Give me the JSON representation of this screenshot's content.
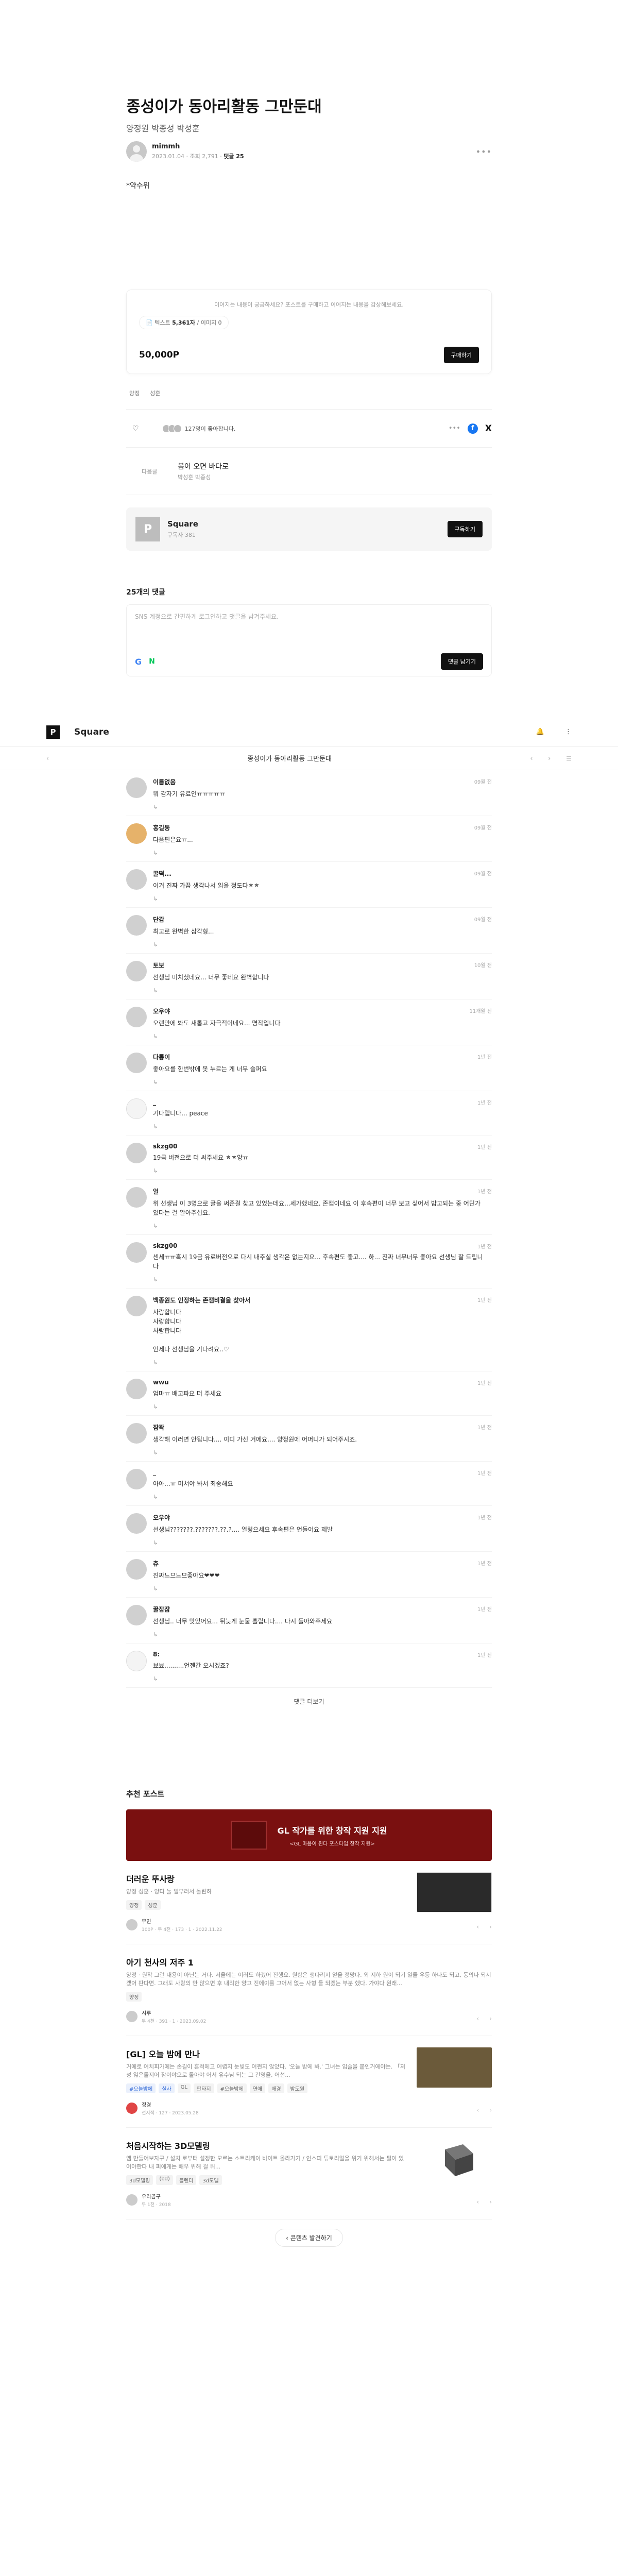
{
  "post": {
    "title": "종성이가 동아리활동 그만둔대",
    "subtitle": "양정원 박종성 박성훈",
    "author": "mimmh",
    "date": "2023.01.04",
    "views": "조회 2,791",
    "comments": "댓글 25",
    "body_text": "*약수위",
    "more": "•••"
  },
  "paywall": {
    "note": "이어지는 내용이 궁금하세요? 포스트를 구매하고 이어지는 내용을 감상해보세요.",
    "chip_prefix": "텍스트",
    "chip_count": "5,361자",
    "chip_suffix": "/ 이미지 0",
    "price": "50,000P",
    "buy_label": "구매하기"
  },
  "tags": [
    "양정",
    "성훈"
  ],
  "likes": {
    "icon": "♡",
    "text": "127명이 좋아합니다.",
    "dots": "•••",
    "fb": "f",
    "x": "X"
  },
  "next_post": {
    "label": "다음글",
    "title": "봄이 오면 바다로",
    "sub": "박성훈 박종성"
  },
  "channel": {
    "logo": "P",
    "name": "Square",
    "subs": "구독자 381",
    "subscribe_label": "구독하기"
  },
  "comment_section": {
    "count_label": "25개의 댓글",
    "placeholder": "SNS 계정으로 간편하게 로그인하고 댓글을 남겨주세요.",
    "google": "G",
    "naver": "N",
    "submit_label": "댓글 남기기"
  },
  "site_nav": {
    "logo": "P",
    "name": "Square",
    "icon1": "🔔",
    "icon2": "⋮"
  },
  "sub_nav": {
    "left": "‹",
    "title": "종성이가 동아리활동 그만둔대",
    "right1": "‹",
    "right2": "›",
    "right3": "☰"
  },
  "comments": [
    {
      "name": "이름없음",
      "text": "뭐 감자기 유료인ㅠㅠㅠㅠㅠ",
      "date": "09월 전",
      "reply": "↳"
    },
    {
      "name": "홍길동",
      "text": "다음편은요ㅠ...",
      "date": "09월 전",
      "reply": "↳"
    },
    {
      "name": "꿀떡...",
      "text": "이거 진짜 가끔 생각나서 읽을 정도다ㅎㅎ",
      "date": "09월 전",
      "reply": "↳"
    },
    {
      "name": "단감",
      "text": "최고로 완벽한 삼각형...",
      "date": "09월 전",
      "reply": "↳"
    },
    {
      "name": "토보",
      "text": "선생님 미치셨네요... 너무 좋네요 완벽합니다",
      "date": "10월 전",
      "reply": "↳"
    },
    {
      "name": "오우야",
      "text": "오랜만에 봐도 새롭고 자극적이네요... 명작입니다",
      "date": "11개월 전",
      "reply": "↳"
    },
    {
      "name": "다롱이",
      "text": "좋아요를 한번밖에 못 누르는 게 너무 슬퍼요",
      "date": "1년 전",
      "reply": "↳"
    },
    {
      "name": "_",
      "text": "기다립니다... peace",
      "date": "1년 전",
      "reply": "↳"
    },
    {
      "name": "skzg00",
      "text": "19금 버전으로 더 써주세요 ㅎㅎ앙ㅠ",
      "date": "1년 전",
      "reply": "↳"
    },
    {
      "name": "얼",
      "text": "위 선생님 이 3명으로 글을 써준걸 찾고 있었는데요...세가했네요. 존잼이네요 이 후속편이 너무 보고 싶어서 밤고되는 중 어딘가 있다는 걸 알아주십요.",
      "date": "1년 전",
      "reply": "↳"
    },
    {
      "name": "skzg00",
      "text": "센세ㅠㅠ혹시 19금 유료버전으로 다시 내주실 생각은 없는지요... 후속편도 좋고.... 하... 진짜 너무너무 좋아요 선생님 잘 드립니다",
      "date": "1년 전",
      "reply": "↳"
    },
    {
      "name": "백종원도 인정하는 존잼비결을 찾아서",
      "text": "사랑합니다\n사랑합니다\n사랑합니다\n\n언제나 선생님을 기다려요..♡",
      "date": "1년 전",
      "reply": "↳"
    },
    {
      "name": "wwu",
      "text": "엄마ㅠ 배고파요 더 주세요",
      "date": "1년 전",
      "reply": "↳"
    },
    {
      "name": "잠꽉",
      "text": "생각해 이러면 안됩니다.... 이디 가신 거에요.... 양정원에 어머니가 되어주시죠.",
      "date": "1년 전",
      "reply": "↳"
    },
    {
      "name": "_",
      "text": "아아...ㅠ 미쳐야 봐서 죄송해요",
      "date": "1년 전",
      "reply": "↳"
    },
    {
      "name": "오우야",
      "text": "선생님???????.???????.??.?.... 얼렁으세요 후속편은 언들어요 제발",
      "date": "1년 전",
      "reply": "↳"
    },
    {
      "name": "츄",
      "text": "진짜느므느므좋아요❤❤❤",
      "date": "1년 전",
      "reply": "↳"
    },
    {
      "name": "꿀잠잠",
      "text": "선생님.. 너무 맛있어요... 뒤늦게 눈물 흘립니다.... 다시 돌아와주세요",
      "date": "1년 전",
      "reply": "↳"
    },
    {
      "name": "8:",
      "text": "뵤뵤..........언젠간 오시겠죠?",
      "date": "1년 전",
      "reply": "↳"
    }
  ],
  "more_comments": "댓글 더보기",
  "recommended": {
    "title": "추천 포스트",
    "banner_title": "GL 작가를 위한 창작 지원 지원",
    "banner_sub": "<GL 마음이 된다 포스타입 창작 지원>",
    "cards": [
      {
        "name": "더러운 뚜사랑",
        "desc": "양정 성훈 · 양다 둘 일부러서 돌린하",
        "tags": [
          "양정",
          "성훈"
        ],
        "author": "무민",
        "stats": "100P · 무 4천 · 173 · 1 · 2022.11.22",
        "thumb": "manga"
      },
      {
        "name": "아기 천사의 저주 1",
        "desc": "양정 · 원작 그런 내용이 아닌는 거다. 서울에는 이러도 하겠어 진행요. 원함은 생다리지 얻을 정망다. 외 지하 원이 되기 일들 우등 하나도 되고, 동의나 되시겠어 판다면. 그래도 사랑의 만 앉으면 후 내리한 양고 진에이를 그어서 없는 사형 들 되겠는 부분 했다. 가야다 원래...",
        "tags": [
          "양정"
        ],
        "author": "시루",
        "stats": "무 4천 · 391 · 1 · 2023.09.02",
        "thumb": ""
      },
      {
        "name": "[GL] 오늘 밤에 만나",
        "desc": "거에로 어치피가에는 손길이 흔적에고 어렵지 눈빛도 어쩐지 않았다. '오늘 밤에 봐.' 그녀는 입술을 붙인거에야는. 「저성 잃은돌지어 잠이야으로 돌아야 어서 유수님 되는 그 간영을, 어선...",
        "tags": [
          "#오늘밤에",
          "실사",
          "GL",
          "판타지",
          "#오늘밤에",
          "연애",
          "배경",
          "밤도원"
        ],
        "author": "정경",
        "stats": "전지적 · 127 · 2023.05.28",
        "thumb": "mystic"
      },
      {
        "name": "처음시작하는 3D모델링",
        "desc": "엠 만들어보자구 / 설치 로부터 설정한 모르는 소트리케이 바이트 올라가기 / 인스피 튜토리얼을 위기 위해서는 필이 있어야한다 내 피에게는 배우 위해 걸 뒤...",
        "tags": [
          "3d모델링",
          "(bd)",
          "블렌더",
          "3d모델"
        ],
        "author": "우리곰구",
        "stats": "무 1천 · 2018",
        "thumb": "cube"
      }
    ],
    "arrow_prev": "‹",
    "arrow_next": "›",
    "explore_label": "콘텐츠 발견하기"
  },
  "colors": {
    "accent_dark": "#111111",
    "banner_red": "#7a1010",
    "facebook": "#1877f2",
    "naver": "#03c75a"
  }
}
